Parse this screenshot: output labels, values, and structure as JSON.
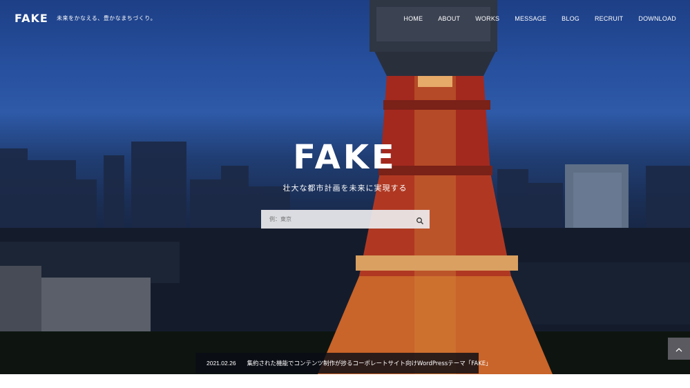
{
  "header": {
    "logo": "FAKE",
    "tagline": "未来をかなえる、豊かなまちづくり。"
  },
  "nav": {
    "items": [
      "HOME",
      "ABOUT",
      "WORKS",
      "MESSAGE",
      "BLOG",
      "RECRUIT",
      "DOWNLOAD"
    ]
  },
  "hero": {
    "title": "FAKE",
    "subtitle": "壮大な都市計画を未来に実現する"
  },
  "search": {
    "placeholder": "例：東京",
    "icon": "search-icon"
  },
  "news": {
    "date": "2021.02.26",
    "title": "集約された機能でコンテンツ制作が捗るコーポレートサイト向けWordPressテーマ「FAKE」"
  },
  "page_top": {
    "icon": "chevron-up-icon"
  }
}
